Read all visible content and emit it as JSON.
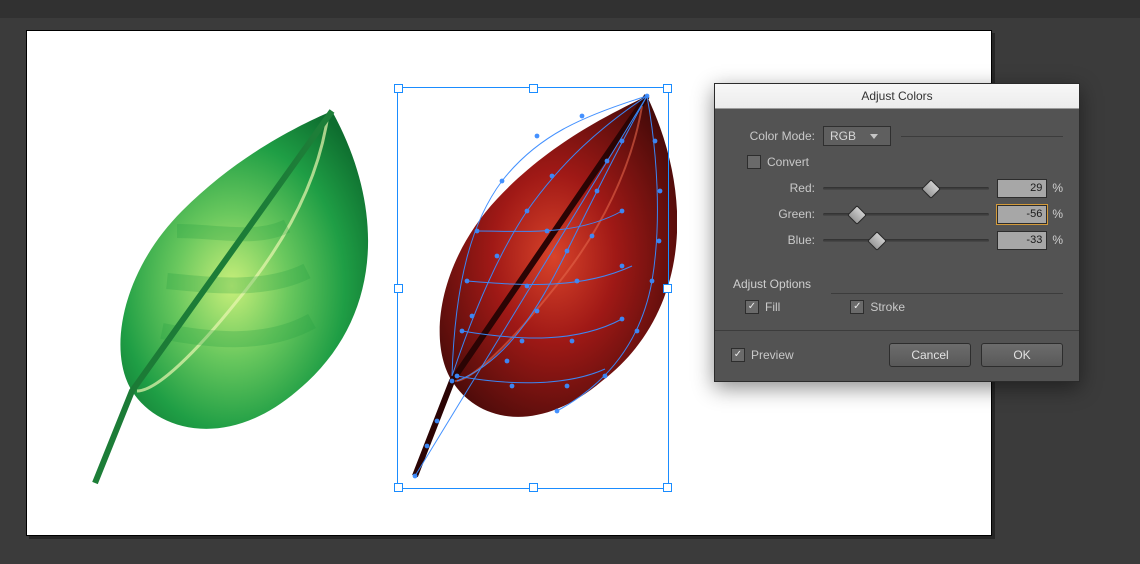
{
  "dialog": {
    "title": "Adjust Colors",
    "color_mode_label": "Color Mode:",
    "color_mode_value": "RGB",
    "convert_label": "Convert",
    "convert_checked": false,
    "channels": {
      "red": {
        "label": "Red:",
        "value": "29",
        "pos_pct": 61
      },
      "green": {
        "label": "Green:",
        "value": "-56",
        "pos_pct": 16,
        "highlight": true
      },
      "blue": {
        "label": "Blue:",
        "value": "-33",
        "pos_pct": 28
      }
    },
    "adjust_options_title": "Adjust Options",
    "fill_label": "Fill",
    "fill_checked": true,
    "stroke_label": "Stroke",
    "stroke_checked": true,
    "preview_label": "Preview",
    "preview_checked": true,
    "cancel": "Cancel",
    "ok": "OK"
  }
}
